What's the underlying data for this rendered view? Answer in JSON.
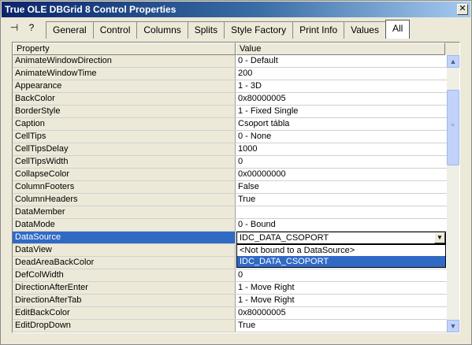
{
  "window": {
    "title": "True OLE DBGrid 8  Control Properties",
    "close_glyph": "✕"
  },
  "toolbar": {
    "pin_glyph": "⊣",
    "help_glyph": "?"
  },
  "tabs": [
    {
      "label": "General"
    },
    {
      "label": "Control"
    },
    {
      "label": "Columns"
    },
    {
      "label": "Splits"
    },
    {
      "label": "Style Factory"
    },
    {
      "label": "Print Info"
    },
    {
      "label": "Values"
    },
    {
      "label": "All"
    }
  ],
  "grid": {
    "headers": {
      "property": "Property",
      "value": "Value"
    },
    "rows": [
      {
        "property": "AnimateWindowDirection",
        "value": "0 - Default"
      },
      {
        "property": "AnimateWindowTime",
        "value": "200"
      },
      {
        "property": "Appearance",
        "value": "1 - 3D"
      },
      {
        "property": "BackColor",
        "value": "0x80000005"
      },
      {
        "property": "BorderStyle",
        "value": "1 - Fixed Single"
      },
      {
        "property": "Caption",
        "value": "Csoport tábla"
      },
      {
        "property": "CellTips",
        "value": "0 - None"
      },
      {
        "property": "CellTipsDelay",
        "value": "1000"
      },
      {
        "property": "CellTipsWidth",
        "value": "0"
      },
      {
        "property": "CollapseColor",
        "value": "0x00000000"
      },
      {
        "property": "ColumnFooters",
        "value": "False"
      },
      {
        "property": "ColumnHeaders",
        "value": "True"
      },
      {
        "property": "DataMember",
        "value": ""
      },
      {
        "property": "DataMode",
        "value": "0 - Bound"
      },
      {
        "property": "DataSource",
        "value": ""
      },
      {
        "property": "DataView",
        "value": ""
      },
      {
        "property": "DeadAreaBackColor",
        "value": ""
      },
      {
        "property": "DefColWidth",
        "value": "0"
      },
      {
        "property": "DirectionAfterEnter",
        "value": "1 - Move Right"
      },
      {
        "property": "DirectionAfterTab",
        "value": "1 - Move Right"
      },
      {
        "property": "EditBackColor",
        "value": "0x80000005"
      },
      {
        "property": "EditDropDown",
        "value": "True"
      }
    ],
    "selected_property": "DataSource"
  },
  "datasource_combo": {
    "value": "IDC_DATA_CSOPORT",
    "options": [
      "<Not bound to a DataSource>",
      "IDC_DATA_CSOPORT"
    ],
    "highlighted": "IDC_DATA_CSOPORT"
  },
  "scrollbar": {
    "up_glyph": "▲",
    "down_glyph": "▼",
    "grip_glyph": "≡"
  },
  "colors": {
    "selection": "#316ac5",
    "title_start": "#0a246a",
    "title_end": "#a6caf0"
  }
}
